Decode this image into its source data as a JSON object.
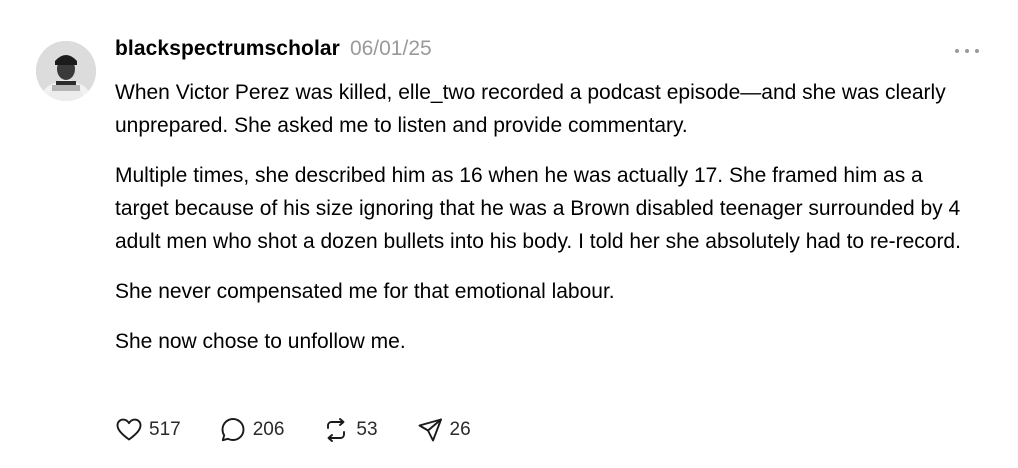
{
  "post": {
    "username": "blackspectrumscholar",
    "date": "06/01/25",
    "paragraphs": [
      "When Victor Perez was killed, elle_two recorded a podcast episode—and she was clearly unprepared. She asked me to listen and provide commentary.",
      "Multiple times, she described him as 16 when he was actually 17. She framed him as a target because of his size ignoring that he was a Brown disabled teenager surrounded by 4 adult men who shot a dozen bullets into his body. I told her she absolutely had to re-record.",
      "She never compensated me for that emotional labour.",
      "She now chose to unfollow me."
    ],
    "actions": {
      "likes": "517",
      "replies": "206",
      "reposts": "53",
      "shares": "26"
    },
    "icons": {
      "like": "heart-icon",
      "reply": "speech-bubble-icon",
      "repost": "repost-icon",
      "share": "send-icon",
      "more": "more-options-icon"
    },
    "colors": {
      "text": "#000000",
      "muted": "#9a9a9a"
    }
  }
}
